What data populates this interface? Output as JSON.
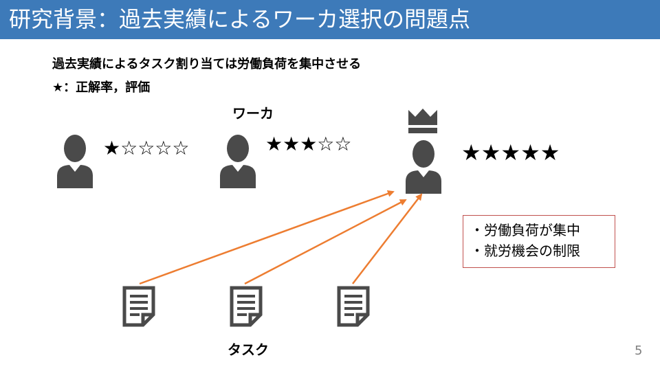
{
  "slide": {
    "title": "研究背景：過去実績によるワーカ選択の問題点",
    "subtitle": "過去実績によるタスク割り当ては労働負荷を集中させる",
    "legend": "★：正解率，評価",
    "workers_label": "ワーカ",
    "tasks_label": "タスク",
    "page_number": "5"
  },
  "workers": [
    {
      "rating": "★☆☆☆☆"
    },
    {
      "rating": "★★★☆☆"
    },
    {
      "rating": "★★★★★"
    }
  ],
  "note": {
    "lines": [
      "・労働負荷が集中",
      "・就労機会の制限"
    ]
  },
  "colors": {
    "title_bar": "#3d7ab9",
    "arrow": "#ed7d31",
    "icon": "#4a4a4a",
    "note_border": "#c0504d"
  }
}
